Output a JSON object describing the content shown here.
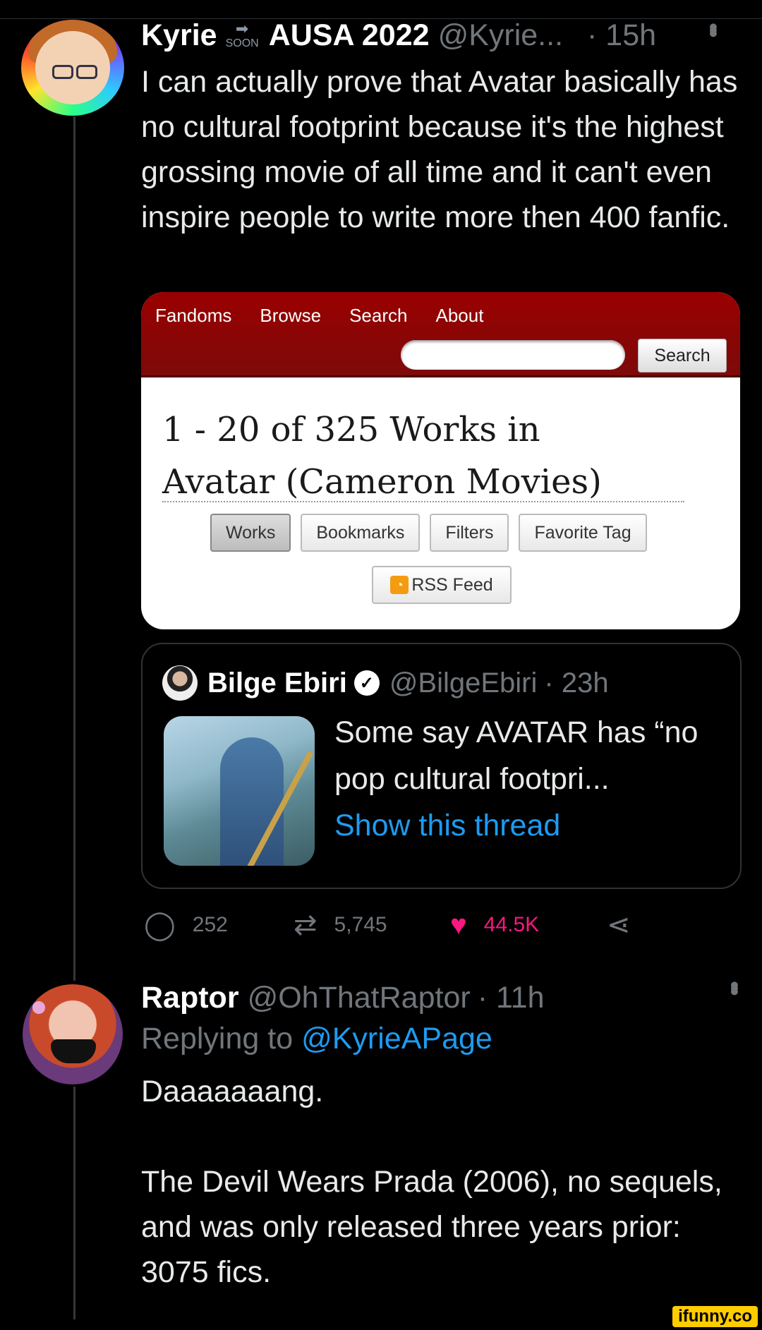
{
  "tweet": {
    "author_name": "Kyrie",
    "badge_text": "SOON",
    "author_suffix": "AUSA 2022",
    "handle": "@Kyrie...",
    "time": "· 15h",
    "text": "I can actually prove that Avatar basically has no cultural footprint because it's the highest grossing movie of all time and it can't even inspire people to write more then 400 fanfic.",
    "replies": "252",
    "retweets": "5,745",
    "likes": "44.5K"
  },
  "ao3": {
    "nav": [
      "Fandoms",
      "Browse",
      "Search",
      "About"
    ],
    "search_button": "Search",
    "title_line1": "1 - 20 of 325 Works in",
    "title_line2": "Avatar (Cameron Movies)",
    "tabs": [
      "Works",
      "Bookmarks",
      "Filters",
      "Favorite Tag"
    ],
    "rss": "RSS Feed",
    "header_color": "#900000"
  },
  "quote": {
    "author_name": "Bilge Ebiri",
    "handle": "@BilgeEbiri",
    "time": "· 23h",
    "text": "Some say AVATAR has “no pop cultural footpri...",
    "link": "Show this thread"
  },
  "reply": {
    "author_name": "Raptor",
    "handle": "@OhThatRaptor",
    "time": "· 11h",
    "replying_prefix": "Replying to",
    "replying_to": "@KyrieAPage",
    "text": "Daaaaaaang.\n\nThe Devil Wears Prada (2006), no sequels, and was only released three years prior: 3075 fics."
  },
  "watermark": "ifunny.co",
  "colors": {
    "background": "#000000",
    "link_blue": "#1d9bf0",
    "like_pink": "#f91880",
    "dim_gray": "#71767b"
  },
  "icons": [
    "reply-icon",
    "retweet-icon",
    "heart-icon",
    "share-icon",
    "more-icon",
    "verified-icon",
    "rss-icon"
  ]
}
